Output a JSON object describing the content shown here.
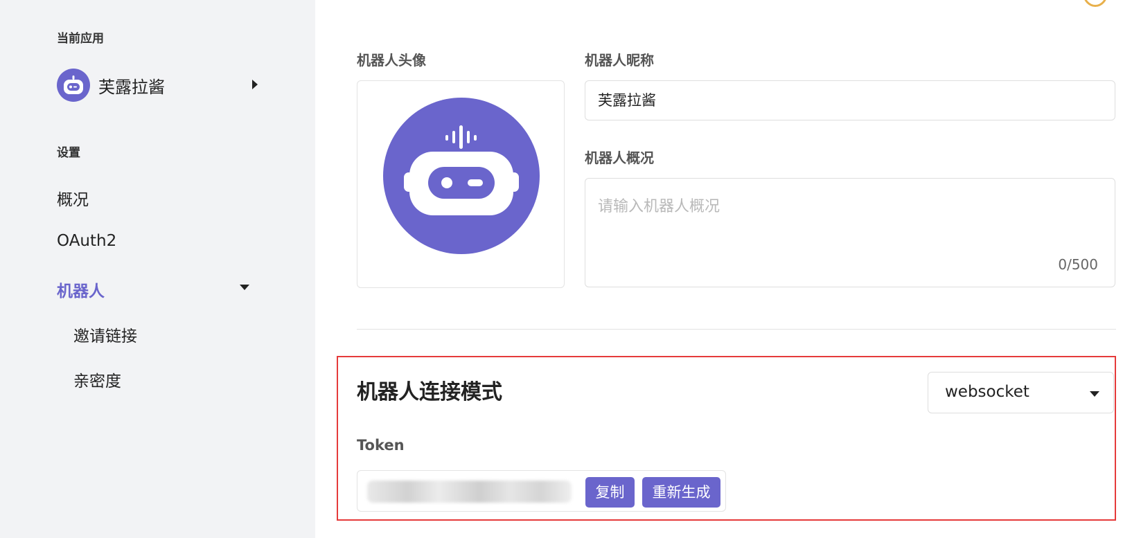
{
  "sidebar": {
    "current_app_label": "当前应用",
    "current_app_name": "芙露拉酱",
    "settings_label": "设置",
    "nav": {
      "overview": "概况",
      "oauth2": "OAuth2",
      "robot": "机器人",
      "invite_link": "邀请链接",
      "intimacy": "亲密度"
    }
  },
  "main": {
    "avatar_label": "机器人头像",
    "nickname_label": "机器人昵称",
    "nickname_value": "芙露拉酱",
    "summary_label": "机器人概况",
    "summary_placeholder": "请输入机器人概况",
    "summary_counter": "0/500",
    "connection_title": "机器人连接模式",
    "connection_mode": "websocket",
    "token_label": "Token",
    "copy_button": "复制",
    "regenerate_button": "重新生成"
  },
  "colors": {
    "accent": "#6a65cc",
    "sidebar_bg": "#f2f3f5",
    "highlight_border": "#e53a3a"
  }
}
